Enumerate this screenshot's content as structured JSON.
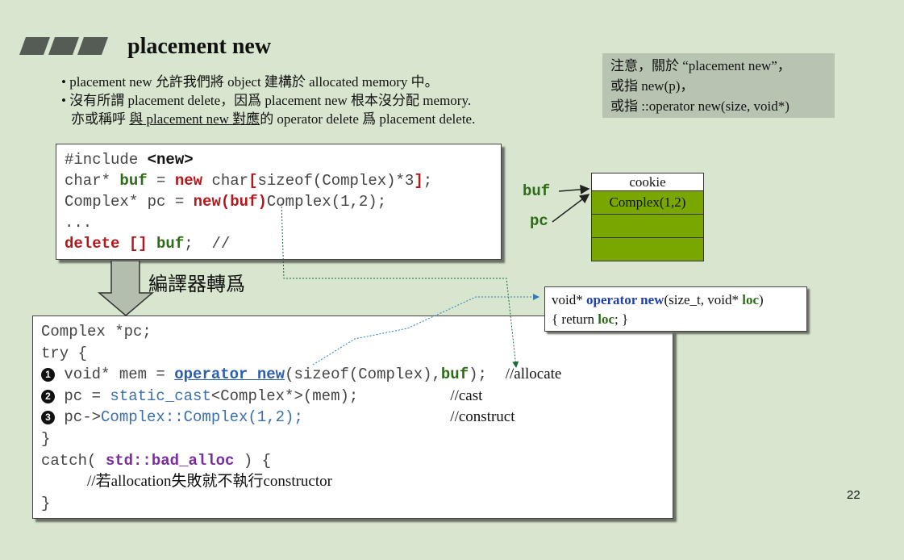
{
  "title": "placement new",
  "bullets": [
    "placement new 允許我們將 object 建構於 allocated memory 中。",
    "沒有所謂 placement delete，因爲 placement new 根本沒分配 memory.",
    "亦或稱呼 ",
    "與 placement new 對應",
    "的 operator delete 爲 placement delete."
  ],
  "note": {
    "line1": "注意，關於 “placement new”，",
    "line2": "或指 new(p)，",
    "line3": "或指 ::operator new(size, void*)"
  },
  "code1": {
    "l1a": "#include ",
    "l1b": "<new>",
    "l2a": "char* ",
    "l2b": "buf",
    "l2c": " = ",
    "l2d": "new",
    "l2e": " char",
    "l2f": "[",
    "l2g": "sizeof(Complex)*3",
    "l2h": "]",
    "l2i": ";",
    "l3a": "Complex* pc = ",
    "l3b": "new",
    "l3c": "(buf)",
    "l3d": "Complex(1,2);",
    "l4": "...",
    "l5a": "delete [] ",
    "l5b": "buf",
    "l5c": ";  //"
  },
  "compile_label": "編譯器轉爲",
  "code2": {
    "l1": "Complex *pc;",
    "l2": "try {",
    "n1": "1",
    "l3a": " void* mem = ",
    "l3b": "operator new",
    "l3c": "(sizeof(Complex),",
    "l3d": "buf",
    "l3e": ");  ",
    "c1": "//allocate",
    "n2": "2",
    "l4a": " pc = ",
    "l4b": "static_cast",
    "l4c": "<Complex*>(mem);",
    "c2": "//cast",
    "n3": "3",
    "l5a": " pc->",
    "l5b": "Complex::Complex(1,2);",
    "c3": "//construct",
    "l6": "}",
    "l7a": "catch( ",
    "l7b": "std::bad_alloc",
    "l7c": " ) {",
    "l8": "//若allocation失敗就不執行constructor",
    "l9": "}"
  },
  "opbox": {
    "l1a": "void* ",
    "l1b": "operator new",
    "l1c": "(size_t, void* ",
    "l1d": "loc",
    "l1e": ")",
    "l2a": "{  return ",
    "l2b": "loc",
    "l2c": ";  }"
  },
  "memory": {
    "labels": [
      "buf",
      "pc"
    ],
    "cells": [
      "cookie",
      "Complex(1,2)",
      "",
      ""
    ]
  },
  "page_number": "22",
  "colors": {
    "background": "#d8e6cf",
    "memory_cell": "#7aa600",
    "note_bg": "#b8c4b2"
  }
}
